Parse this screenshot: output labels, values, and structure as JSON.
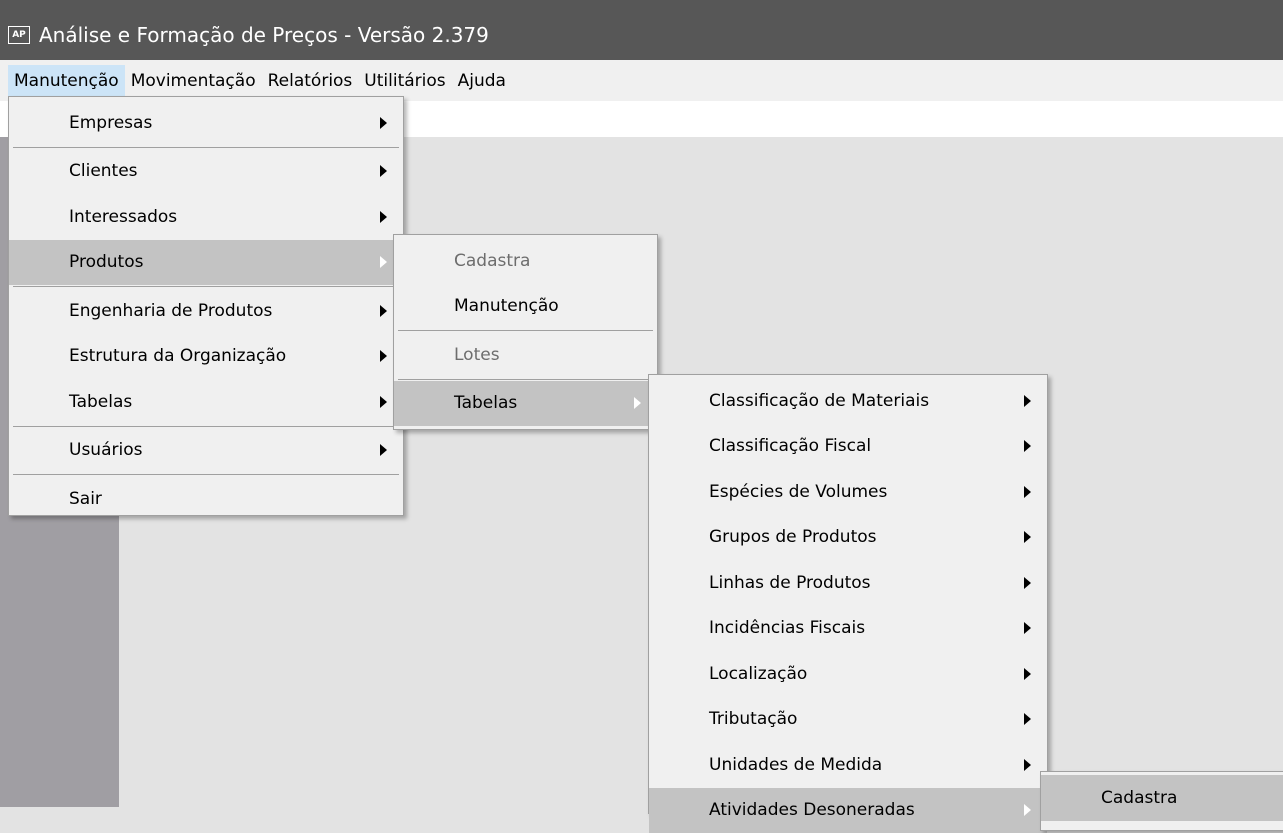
{
  "window": {
    "icon_text": "AP",
    "title": "Análise e Formação de Preços - Versão 2.379"
  },
  "menubar": [
    "Manutenção",
    "Movimentação",
    "Relatórios",
    "Utilitários",
    "Ajuda"
  ],
  "menu_manutencao": {
    "empresas": "Empresas",
    "clientes": "Clientes",
    "interessados": "Interessados",
    "produtos": "Produtos",
    "engenharia": "Engenharia de Produtos",
    "estrutura": "Estrutura da Organização",
    "tabelas": "Tabelas",
    "usuarios": "Usuários",
    "sair": "Sair"
  },
  "menu_produtos": {
    "cadastra": "Cadastra",
    "manutencao": "Manutenção",
    "lotes": "Lotes",
    "tabelas": "Tabelas"
  },
  "menu_tabelas": [
    "Classificação de Materiais",
    "Classificação Fiscal",
    "Espécies de Volumes",
    "Grupos de Produtos",
    "Linhas de Produtos",
    "Incidências Fiscais",
    "Localização",
    "Tributação",
    "Unidades de Medida",
    "Atividades Desoneradas"
  ],
  "menu_atividades": {
    "cadastra": "Cadastra"
  },
  "colors": {
    "titlebar": "#575757",
    "menu_highlight": "#c3c3c3",
    "menubar_active": "#cce4f7"
  }
}
